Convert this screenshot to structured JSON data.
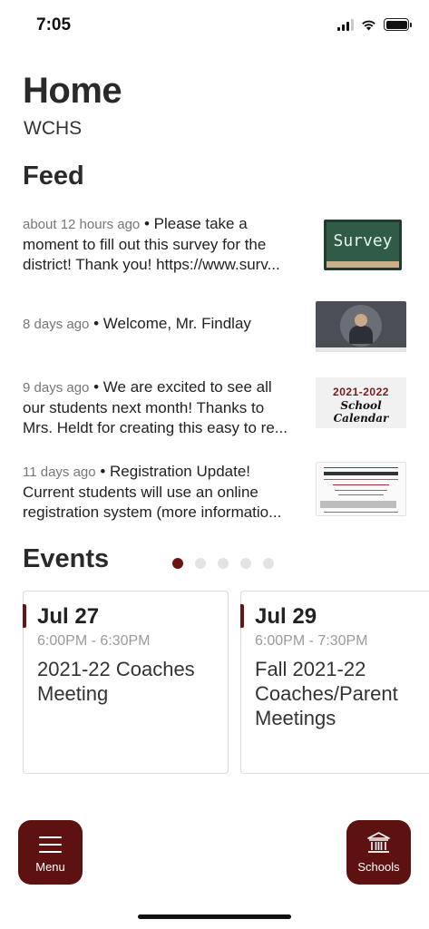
{
  "status_bar": {
    "time": "7:05"
  },
  "header": {
    "title": "Home",
    "subtitle": "WCHS"
  },
  "feed": {
    "title": "Feed",
    "items": [
      {
        "meta": "about 12 hours ago",
        "lines": [
          "about 12 hours ago • Please take a",
          "moment to fill out this survey for the",
          "district! Thank you! https://www.surv..."
        ],
        "thumbnail_text": "Survey"
      },
      {
        "meta": "8 days ago",
        "lines": [
          "8 days ago • Welcome, Mr. Findlay"
        ]
      },
      {
        "meta": "9 days ago",
        "lines": [
          "9 days ago • We are excited to see all",
          "our students next month! Thanks to",
          "Mrs. Heldt for creating this easy to re..."
        ],
        "thumbnail_year": "2021-2022",
        "thumbnail_text": "School Calendar"
      },
      {
        "meta": "11 days ago",
        "lines": [
          "11 days ago • Registration Update!",
          "Current students will use an online",
          "registration system (more informatio..."
        ]
      }
    ]
  },
  "events": {
    "title": "Events",
    "dots": 5,
    "active_dot": 0,
    "cards": [
      {
        "date": "Jul 27",
        "time": "6:00PM - 6:30PM",
        "name": "2021-22 Coaches Meeting"
      },
      {
        "date": "Jul 29",
        "time": "6:00PM - 7:30PM",
        "name": "Fall 2021-22 Coaches/Parent Meetings"
      }
    ]
  },
  "bottom_nav": {
    "menu_label": "Menu",
    "schools_label": "Schools"
  },
  "colors": {
    "accent": "#6a1414",
    "fab": "#5e1111"
  }
}
